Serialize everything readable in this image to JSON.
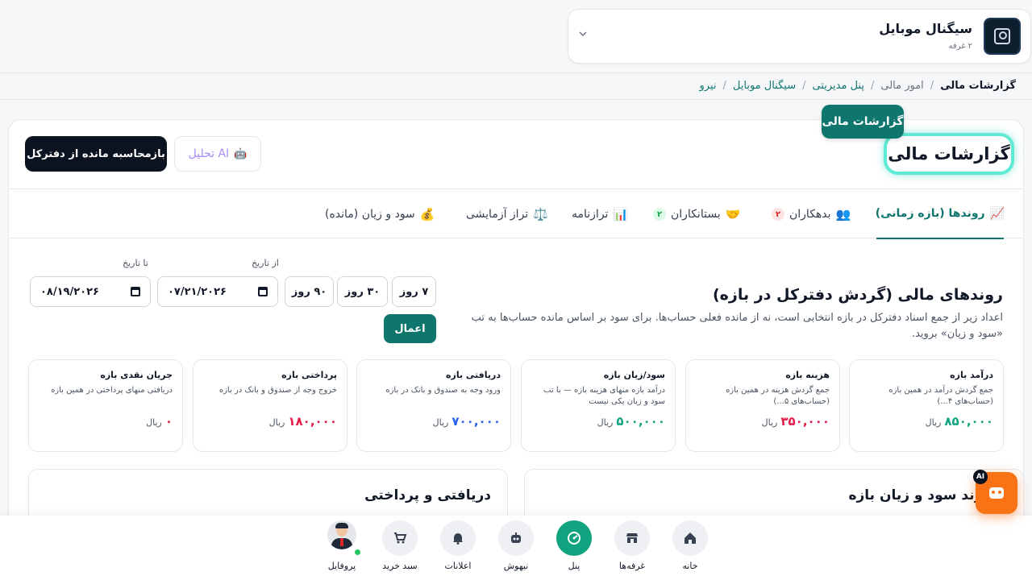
{
  "store": {
    "name": "سیگنال موبایل",
    "rooms": "۲ غرفه"
  },
  "breadcrumb": {
    "items": [
      "نیرو",
      "سیگنال موبایل",
      "پنل مدیریتی",
      "امور مالی",
      "گزارشات مالی"
    ]
  },
  "header": {
    "tooltip": "گزارشات مالی",
    "title": "گزارشات مالی",
    "ai_button": "تحلیل AI",
    "recalc_button": "بازمحاسبه مانده از دفترکل"
  },
  "tabs": [
    {
      "label": "روندها (بازه زمانی)",
      "icon": "📈"
    },
    {
      "label": "بدهکاران",
      "icon": "👥",
      "badge": "۲"
    },
    {
      "label": "بستانکاران",
      "icon": "🤝",
      "badge": "۲"
    },
    {
      "label": "ترازنامه",
      "icon": "📊"
    },
    {
      "label": "تراز آزمایشی",
      "icon": "⚖️"
    },
    {
      "label": "سود و زیان  (مانده)",
      "icon": "💰"
    }
  ],
  "trends": {
    "title": "روندهای مالی (گردش دفترکل در بازه)",
    "description": "اعداد زیر از جمع اسناد دفترکل در بازه انتخابی است، نه از مانده فعلی حساب‌ها. برای سود بر اساس مانده حساب‌ها به تب «سود و زیان» بروید.",
    "periods": [
      "۷ روز",
      "۳۰ روز",
      "۹۰ روز"
    ],
    "from_label": "از تاریخ",
    "from_value": "۰۷/۲۱/۲۰۲۶",
    "to_label": "تا تاریخ",
    "to_value": "۰۸/۱۹/۲۰۲۶",
    "apply": "اعمال"
  },
  "stats": [
    {
      "title": "درآمد بازه",
      "desc": "جمع گردش درآمد در همین بازه (حساب‌های ۴...)",
      "value": "۸۵۰,۰۰۰",
      "unit": "ریال",
      "color": "#10a37f"
    },
    {
      "title": "هزینه بازه",
      "desc": "جمع گردش هزینه در همین بازه (حساب‌های ۵...)",
      "value": "۳۵۰,۰۰۰",
      "unit": "ریال",
      "color": "#e11d48"
    },
    {
      "title": "سود/زیان بازه",
      "desc": "درآمد بازه منهای هزینه بازه — با تب سود و زیان یکی نیست",
      "value": "۵۰۰,۰۰۰",
      "unit": "ریال",
      "color": "#10a37f"
    },
    {
      "title": "دریافتی بازه",
      "desc": "ورود وجه به صندوق و بانک در بازه",
      "value": "۷۰۰,۰۰۰",
      "unit": "ریال",
      "color": "#2563eb"
    },
    {
      "title": "پرداختی بازه",
      "desc": "خروج وجه از صندوق و بانک در بازه",
      "value": "۱۸۰,۰۰۰",
      "unit": "ریال",
      "color": "#e11d48"
    },
    {
      "title": "جریان نقدی بازه",
      "desc": "دریافتی منهای پرداختی در همین بازه",
      "value": "۰",
      "unit": "ریال",
      "color": "#e11d48"
    }
  ],
  "panels": {
    "profit_trend": "روند سود و زیان بازه",
    "receipts": "دریافتی و پرداختی"
  },
  "fab": {
    "badge": "AI"
  },
  "nav": [
    {
      "label": "خانه",
      "icon": "⌂"
    },
    {
      "label": "غرفه‌ها",
      "icon": "▤"
    },
    {
      "label": "پنل",
      "icon": "◔"
    },
    {
      "label": "نیهوش",
      "icon": "☺"
    },
    {
      "label": "اعلانات",
      "icon": "🔔"
    },
    {
      "label": "سبد خرید",
      "icon": "🛒"
    },
    {
      "label": "پروفایل",
      "icon": "avatar"
    }
  ],
  "colors": {
    "primary": "#0f766e",
    "accent": "#10a37f",
    "dark": "#0b1220",
    "fab": "#f97316"
  }
}
